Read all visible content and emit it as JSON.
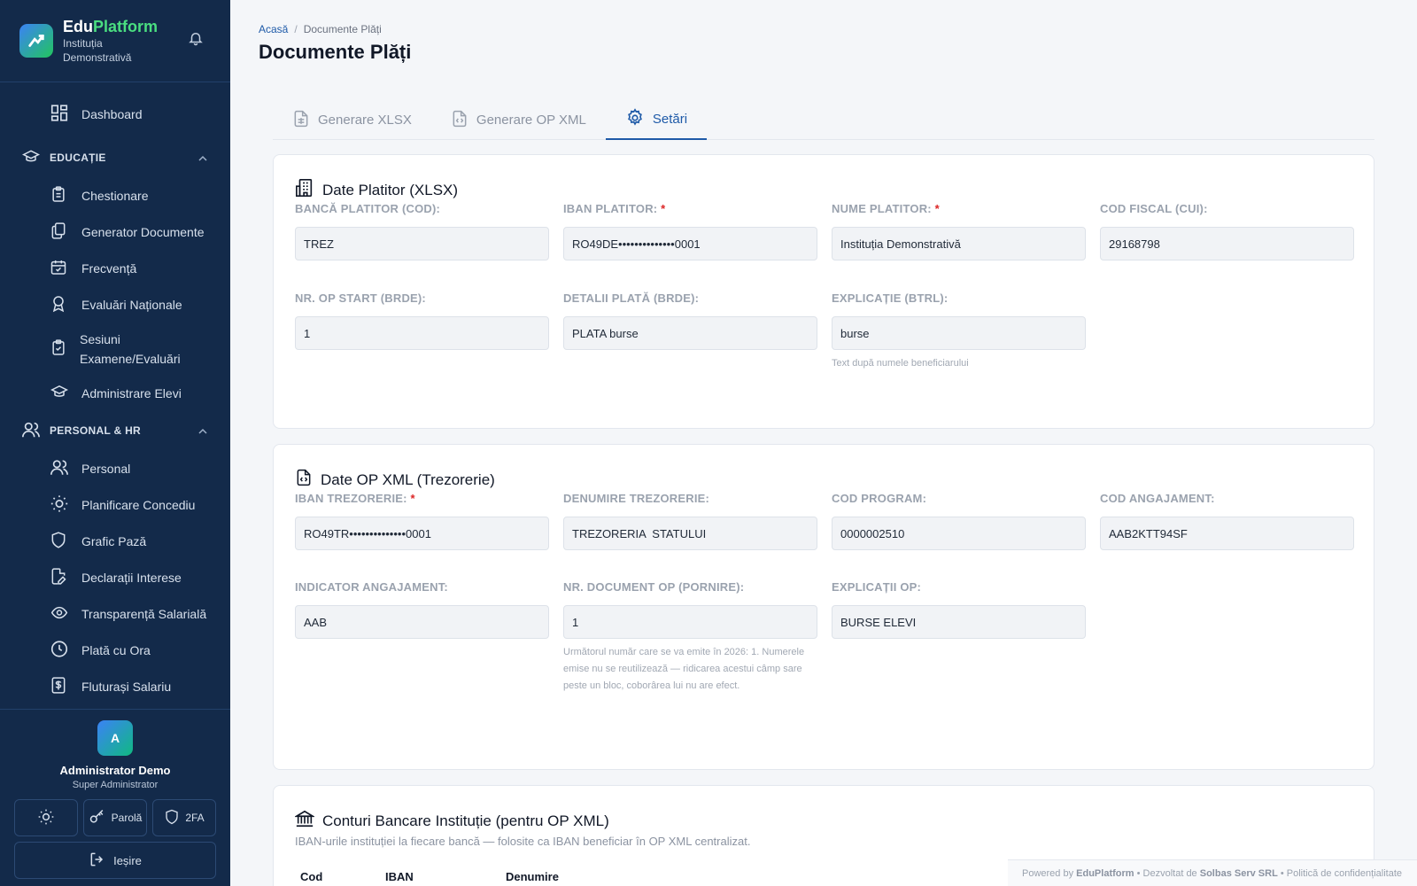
{
  "app": {
    "brand_name_1": "Edu",
    "brand_name_2": "Platform",
    "brand_sub_1": "Instituția",
    "brand_sub_2": "Demonstrativă"
  },
  "sidebar": {
    "dashboard": "Dashboard",
    "sections": [
      {
        "label": "EDUCAȚIE"
      },
      {
        "label": "PERSONAL & HR"
      }
    ],
    "education_items": [
      {
        "label": "Chestionare",
        "icon": "clipboard-icon"
      },
      {
        "label": "Generator Documente",
        "icon": "documents-icon"
      },
      {
        "label": "Frecvență",
        "icon": "calendar-check-icon"
      },
      {
        "label": "Evaluări Naționale",
        "icon": "award-icon"
      },
      {
        "label": "Sesiuni",
        "label2": "Examene/Evaluări",
        "icon": "clipboard-check-icon"
      },
      {
        "label": "Administrare Elevi",
        "icon": "graduation-cap-icon"
      }
    ],
    "hr_items": [
      {
        "label": "Personal",
        "icon": "users-icon"
      },
      {
        "label": "Planificare Concediu",
        "icon": "sun-icon"
      },
      {
        "label": "Grafic Pază",
        "icon": "shield-icon"
      },
      {
        "label": "Declarații Interese",
        "icon": "file-edit-icon"
      },
      {
        "label": "Transparență Salarială",
        "icon": "eye-icon"
      },
      {
        "label": "Plată cu Ora",
        "icon": "clock-icon"
      },
      {
        "label": "Fluturași Salariu",
        "icon": "dollar-file-icon"
      }
    ]
  },
  "user": {
    "initial": "A",
    "name": "Administrator Demo",
    "role": "Super Administrator",
    "password_label": "Parolă",
    "twofa_label": "2FA",
    "logout_label": "Ieșire"
  },
  "breadcrumb": {
    "home": "Acasă",
    "separator": "/",
    "current": "Documente Plăți"
  },
  "page_title": "Documente Plăți",
  "tabs": [
    {
      "label": "Generare XLSX",
      "active": false
    },
    {
      "label": "Generare OP XML",
      "active": false
    },
    {
      "label": "Setări",
      "active": true
    }
  ],
  "payer_card": {
    "title": "Date Platitor (XLSX)",
    "fields": [
      {
        "label": "BANCĂ PLATITOR (COD):",
        "required": false,
        "value": "TREZ"
      },
      {
        "label": "IBAN PLATITOR:",
        "required": true,
        "value": "RO49DE••••••••••••••0001"
      },
      {
        "label": "NUME PLATITOR:",
        "required": true,
        "value": "Instituția Demonstrativă"
      },
      {
        "label": "COD FISCAL (CUI):",
        "required": false,
        "value": "29168798"
      },
      {
        "label": "NR. OP START (BRDE):",
        "required": false,
        "value": "1"
      },
      {
        "label": "DETALII PLATĂ (BRDE):",
        "required": false,
        "value": "PLATA burse"
      },
      {
        "label": "EXPLICAȚIE (BTRL):",
        "required": false,
        "value": "burse",
        "help": "Text după numele beneficiarului"
      }
    ]
  },
  "op_card": {
    "title": "Date OP XML (Trezorerie)",
    "fields": [
      {
        "label": "IBAN TREZORERIE:",
        "required": true,
        "value": "RO49TR••••••••••••••0001"
      },
      {
        "label": "DENUMIRE TREZORERIE:",
        "required": false,
        "value": "TREZORERIA  STATULUI"
      },
      {
        "label": "COD PROGRAM:",
        "required": false,
        "value": "0000002510"
      },
      {
        "label": "COD ANGAJAMENT:",
        "required": false,
        "value": "AAB2KTT94SF"
      },
      {
        "label": "INDICATOR ANGAJAMENT:",
        "required": false,
        "value": "AAB"
      },
      {
        "label": "NR. DOCUMENT OP (PORNIRE):",
        "required": false,
        "value": "1",
        "help": "Următorul număr care se va emite în 2026: 1. Numerele emise nu se reutilizează — ridicarea acestui câmp sare peste un bloc, coborârea lui nu are efect."
      },
      {
        "label": "EXPLICAȚII OP:",
        "required": false,
        "value": "BURSE ELEVI"
      }
    ]
  },
  "accounts_card": {
    "title": "Conturi Bancare Instituție (pentru OP XML)",
    "subtitle": "IBAN-urile instituției la fiecare bancă — folosite ca IBAN beneficiar în OP XML centralizat.",
    "columns": [
      "Cod",
      "IBAN",
      "Denumire"
    ]
  },
  "footer": {
    "powered": "Powered by",
    "platform": "EduPlatform",
    "dev": "• Dezvoltat de",
    "company": "Solbas Serv SRL",
    "privacy": "• Politică de confidențialitate"
  },
  "colors": {
    "sidebar_bg": "#132a4a",
    "accent": "#1e5aa8",
    "brand_green": "#4ade80",
    "required": "#dc2626"
  }
}
